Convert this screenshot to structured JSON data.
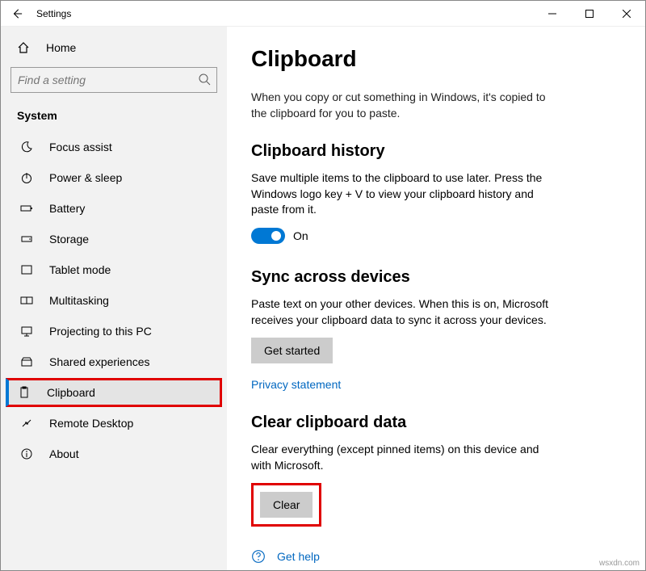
{
  "titlebar": {
    "title": "Settings"
  },
  "sidebar": {
    "home": "Home",
    "search_placeholder": "Find a setting",
    "category": "System",
    "items": [
      {
        "label": "Focus assist"
      },
      {
        "label": "Power & sleep"
      },
      {
        "label": "Battery"
      },
      {
        "label": "Storage"
      },
      {
        "label": "Tablet mode"
      },
      {
        "label": "Multitasking"
      },
      {
        "label": "Projecting to this PC"
      },
      {
        "label": "Shared experiences"
      },
      {
        "label": "Clipboard"
      },
      {
        "label": "Remote Desktop"
      },
      {
        "label": "About"
      }
    ]
  },
  "main": {
    "title": "Clipboard",
    "intro": "When you copy or cut something in Windows, it's copied to the clipboard for you to paste.",
    "history": {
      "heading": "Clipboard history",
      "text": "Save multiple items to the clipboard to use later. Press the Windows logo key + V to view your clipboard history and paste from it.",
      "toggle_label": "On"
    },
    "sync": {
      "heading": "Sync across devices",
      "text": "Paste text on your other devices. When this is on, Microsoft receives your clipboard data to sync it across your devices.",
      "button": "Get started",
      "privacy": "Privacy statement"
    },
    "clear": {
      "heading": "Clear clipboard data",
      "text": "Clear everything (except pinned items) on this device and with Microsoft.",
      "button": "Clear"
    },
    "help": "Get help"
  },
  "watermark": "wsxdn.com"
}
